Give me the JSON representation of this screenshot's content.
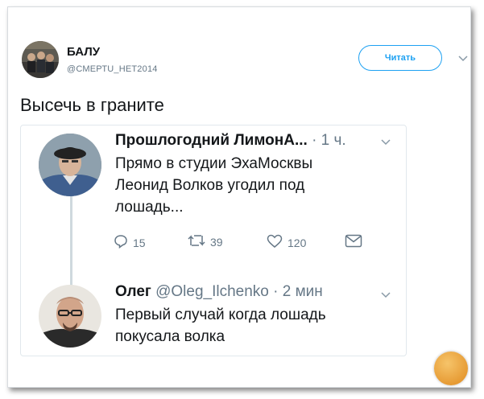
{
  "tweet": {
    "author_name": "БАЛУ",
    "author_handle": "@СМЕРТU_НЕТ2014",
    "follow_label": "Читать",
    "text": "Высечь в граните"
  },
  "quote": {
    "first": {
      "name": "Прошлогодний ЛимонА...",
      "time": "· 1 ч.",
      "lines": [
        "Прямо в студии ЭхаМосквы",
        "Леонид Волков угодил под",
        "лошадь..."
      ],
      "replies": "15",
      "retweets": "39",
      "likes": "120"
    },
    "second": {
      "name": "Олег",
      "handle": "@Oleg_Ilchenko",
      "time": "· 2 мин",
      "lines": [
        "Первый случай когда лошадь",
        "покусала волка"
      ]
    }
  },
  "colors": {
    "accent": "#1da1f2",
    "muted": "#657786",
    "border": "#e1e8ed"
  },
  "icons": [
    "reply-icon",
    "retweet-icon",
    "like-icon",
    "message-icon",
    "chevron-down-icon"
  ]
}
